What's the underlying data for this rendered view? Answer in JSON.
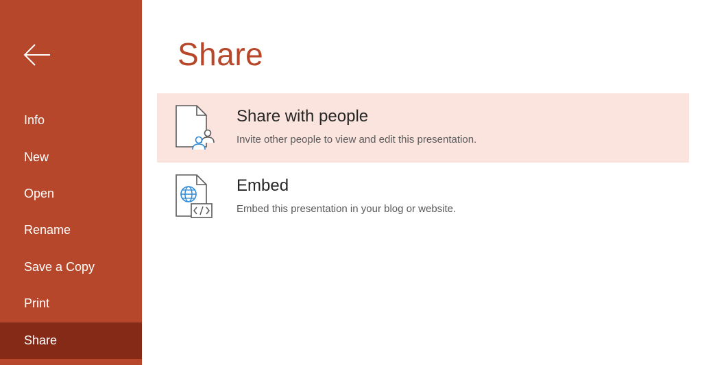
{
  "sidebar": {
    "back_icon": "arrow-left-icon",
    "items": [
      {
        "label": "Info"
      },
      {
        "label": "New"
      },
      {
        "label": "Open"
      },
      {
        "label": "Rename"
      },
      {
        "label": "Save a Copy"
      },
      {
        "label": "Print"
      },
      {
        "label": "Share",
        "active": true
      }
    ]
  },
  "main": {
    "title": "Share",
    "options": [
      {
        "title": "Share with people",
        "description": "Invite other people to view and edit this presentation.",
        "icon": "share-with-people-icon",
        "selected": true
      },
      {
        "title": "Embed",
        "description": "Embed this presentation in your blog or website.",
        "icon": "embed-icon",
        "selected": false
      }
    ]
  },
  "colors": {
    "accent": "#b7472a",
    "sidebar_active": "#842a16",
    "selected_bg": "#fce4de",
    "icon_blue": "#2b88d8"
  }
}
